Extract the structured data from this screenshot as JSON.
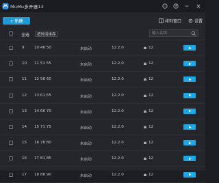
{
  "titlebar": {
    "title": "MuMu多开器12",
    "logo_icon": "mumu-logo-icon",
    "icons": [
      "chat-icon",
      "help-icon",
      "minimize-icon",
      "close-icon"
    ]
  },
  "toolbar": {
    "new_label": "+ 新建",
    "arrange_label": "排列窗口",
    "settings_label": "设置"
  },
  "header": {
    "select_all_label": "全选",
    "sort_label": "按时间排序",
    "search_placeholder": "输入名称"
  },
  "rows": [
    {
      "index": "9",
      "name": "10 46 50",
      "status": "未启动",
      "version": "12.2.0",
      "resolution": "12"
    },
    {
      "index": "10",
      "name": "11 51 55",
      "status": "未启动",
      "version": "12.2.0",
      "resolution": "12"
    },
    {
      "index": "11",
      "name": "12 56 60",
      "status": "未启动",
      "version": "12.2.0",
      "resolution": "12"
    },
    {
      "index": "12",
      "name": "13 61 65",
      "status": "未启动",
      "version": "12.2.0",
      "resolution": "12"
    },
    {
      "index": "13",
      "name": "14 66 70",
      "status": "未启动",
      "version": "12.2.0",
      "resolution": "12"
    },
    {
      "index": "14",
      "name": "15 71 75",
      "status": "未启动",
      "version": "12.2.0",
      "resolution": "12"
    },
    {
      "index": "15",
      "name": "16 76 80",
      "status": "未启动",
      "version": "12.2.0",
      "resolution": "12"
    },
    {
      "index": "16",
      "name": "17 81 85",
      "status": "未启动",
      "version": "12.2.0",
      "resolution": "12"
    },
    {
      "index": "17",
      "name": "18 86 90",
      "status": "未启动",
      "version": "12.2.0",
      "resolution": "12"
    }
  ],
  "colors": {
    "accent": "#1aa8e8",
    "background": "#24262b",
    "titlebar": "#1b1c20"
  }
}
